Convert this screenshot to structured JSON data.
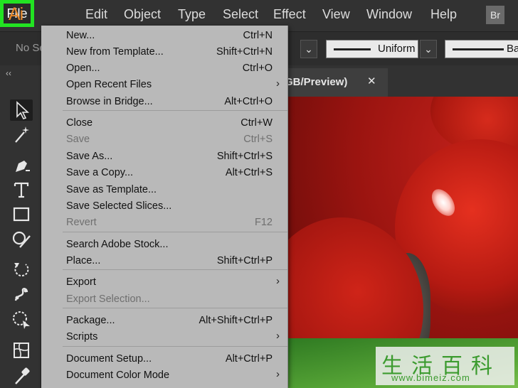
{
  "app": {
    "logo": "Ai",
    "bridge_badge": "Br"
  },
  "menubar": {
    "items": [
      "File",
      "Edit",
      "Object",
      "Type",
      "Select",
      "Effect",
      "View",
      "Window",
      "Help"
    ]
  },
  "controlbar": {
    "selection_text": "No Se",
    "stroke_profile": "Uniform",
    "brush_text": "Ba"
  },
  "document_tab": {
    "title": "GB/Preview)",
    "close_glyph": "✕"
  },
  "file_menu": {
    "items": [
      {
        "label": "New...",
        "shortcut": "Ctrl+N"
      },
      {
        "label": "New from Template...",
        "shortcut": "Shift+Ctrl+N"
      },
      {
        "label": "Open...",
        "shortcut": "Ctrl+O"
      },
      {
        "label": "Open Recent Files",
        "submenu": true
      },
      {
        "label": "Browse in Bridge...",
        "shortcut": "Alt+Ctrl+O"
      },
      {
        "label": "Close",
        "shortcut": "Ctrl+W"
      },
      {
        "label": "Save",
        "shortcut": "Ctrl+S",
        "disabled": true
      },
      {
        "label": "Save As...",
        "shortcut": "Shift+Ctrl+S"
      },
      {
        "label": "Save a Copy...",
        "shortcut": "Alt+Ctrl+S"
      },
      {
        "label": "Save as Template..."
      },
      {
        "label": "Save Selected Slices..."
      },
      {
        "label": "Revert",
        "shortcut": "F12",
        "disabled": true
      },
      {
        "label": "Search Adobe Stock..."
      },
      {
        "label": "Place...",
        "shortcut": "Shift+Ctrl+P"
      },
      {
        "label": "Export",
        "submenu": true
      },
      {
        "label": "Export Selection...",
        "disabled": true
      },
      {
        "label": "Package...",
        "shortcut": "Alt+Shift+Ctrl+P"
      },
      {
        "label": "Scripts",
        "submenu": true
      },
      {
        "label": "Document Setup...",
        "shortcut": "Alt+Ctrl+P"
      },
      {
        "label": "Document Color Mode",
        "submenu": true
      }
    ],
    "submenu_arrow": "›"
  },
  "tools": [
    "selection-tool",
    "magic-wand-tool",
    "pen-tool",
    "type-tool",
    "rectangle-tool",
    "shaper-tool",
    "rotate-tool",
    "puppet-warp-tool",
    "free-transform-tool",
    "mesh-tool",
    "eyedropper-tool"
  ],
  "watermark": {
    "chars": "生活百科",
    "url": "www.bimeiz.com"
  },
  "colors": {
    "highlight": "#22e322",
    "menu_bg": "#b9b9b9",
    "ui_dark": "#323232",
    "ai_orange": "#e88a2c"
  }
}
